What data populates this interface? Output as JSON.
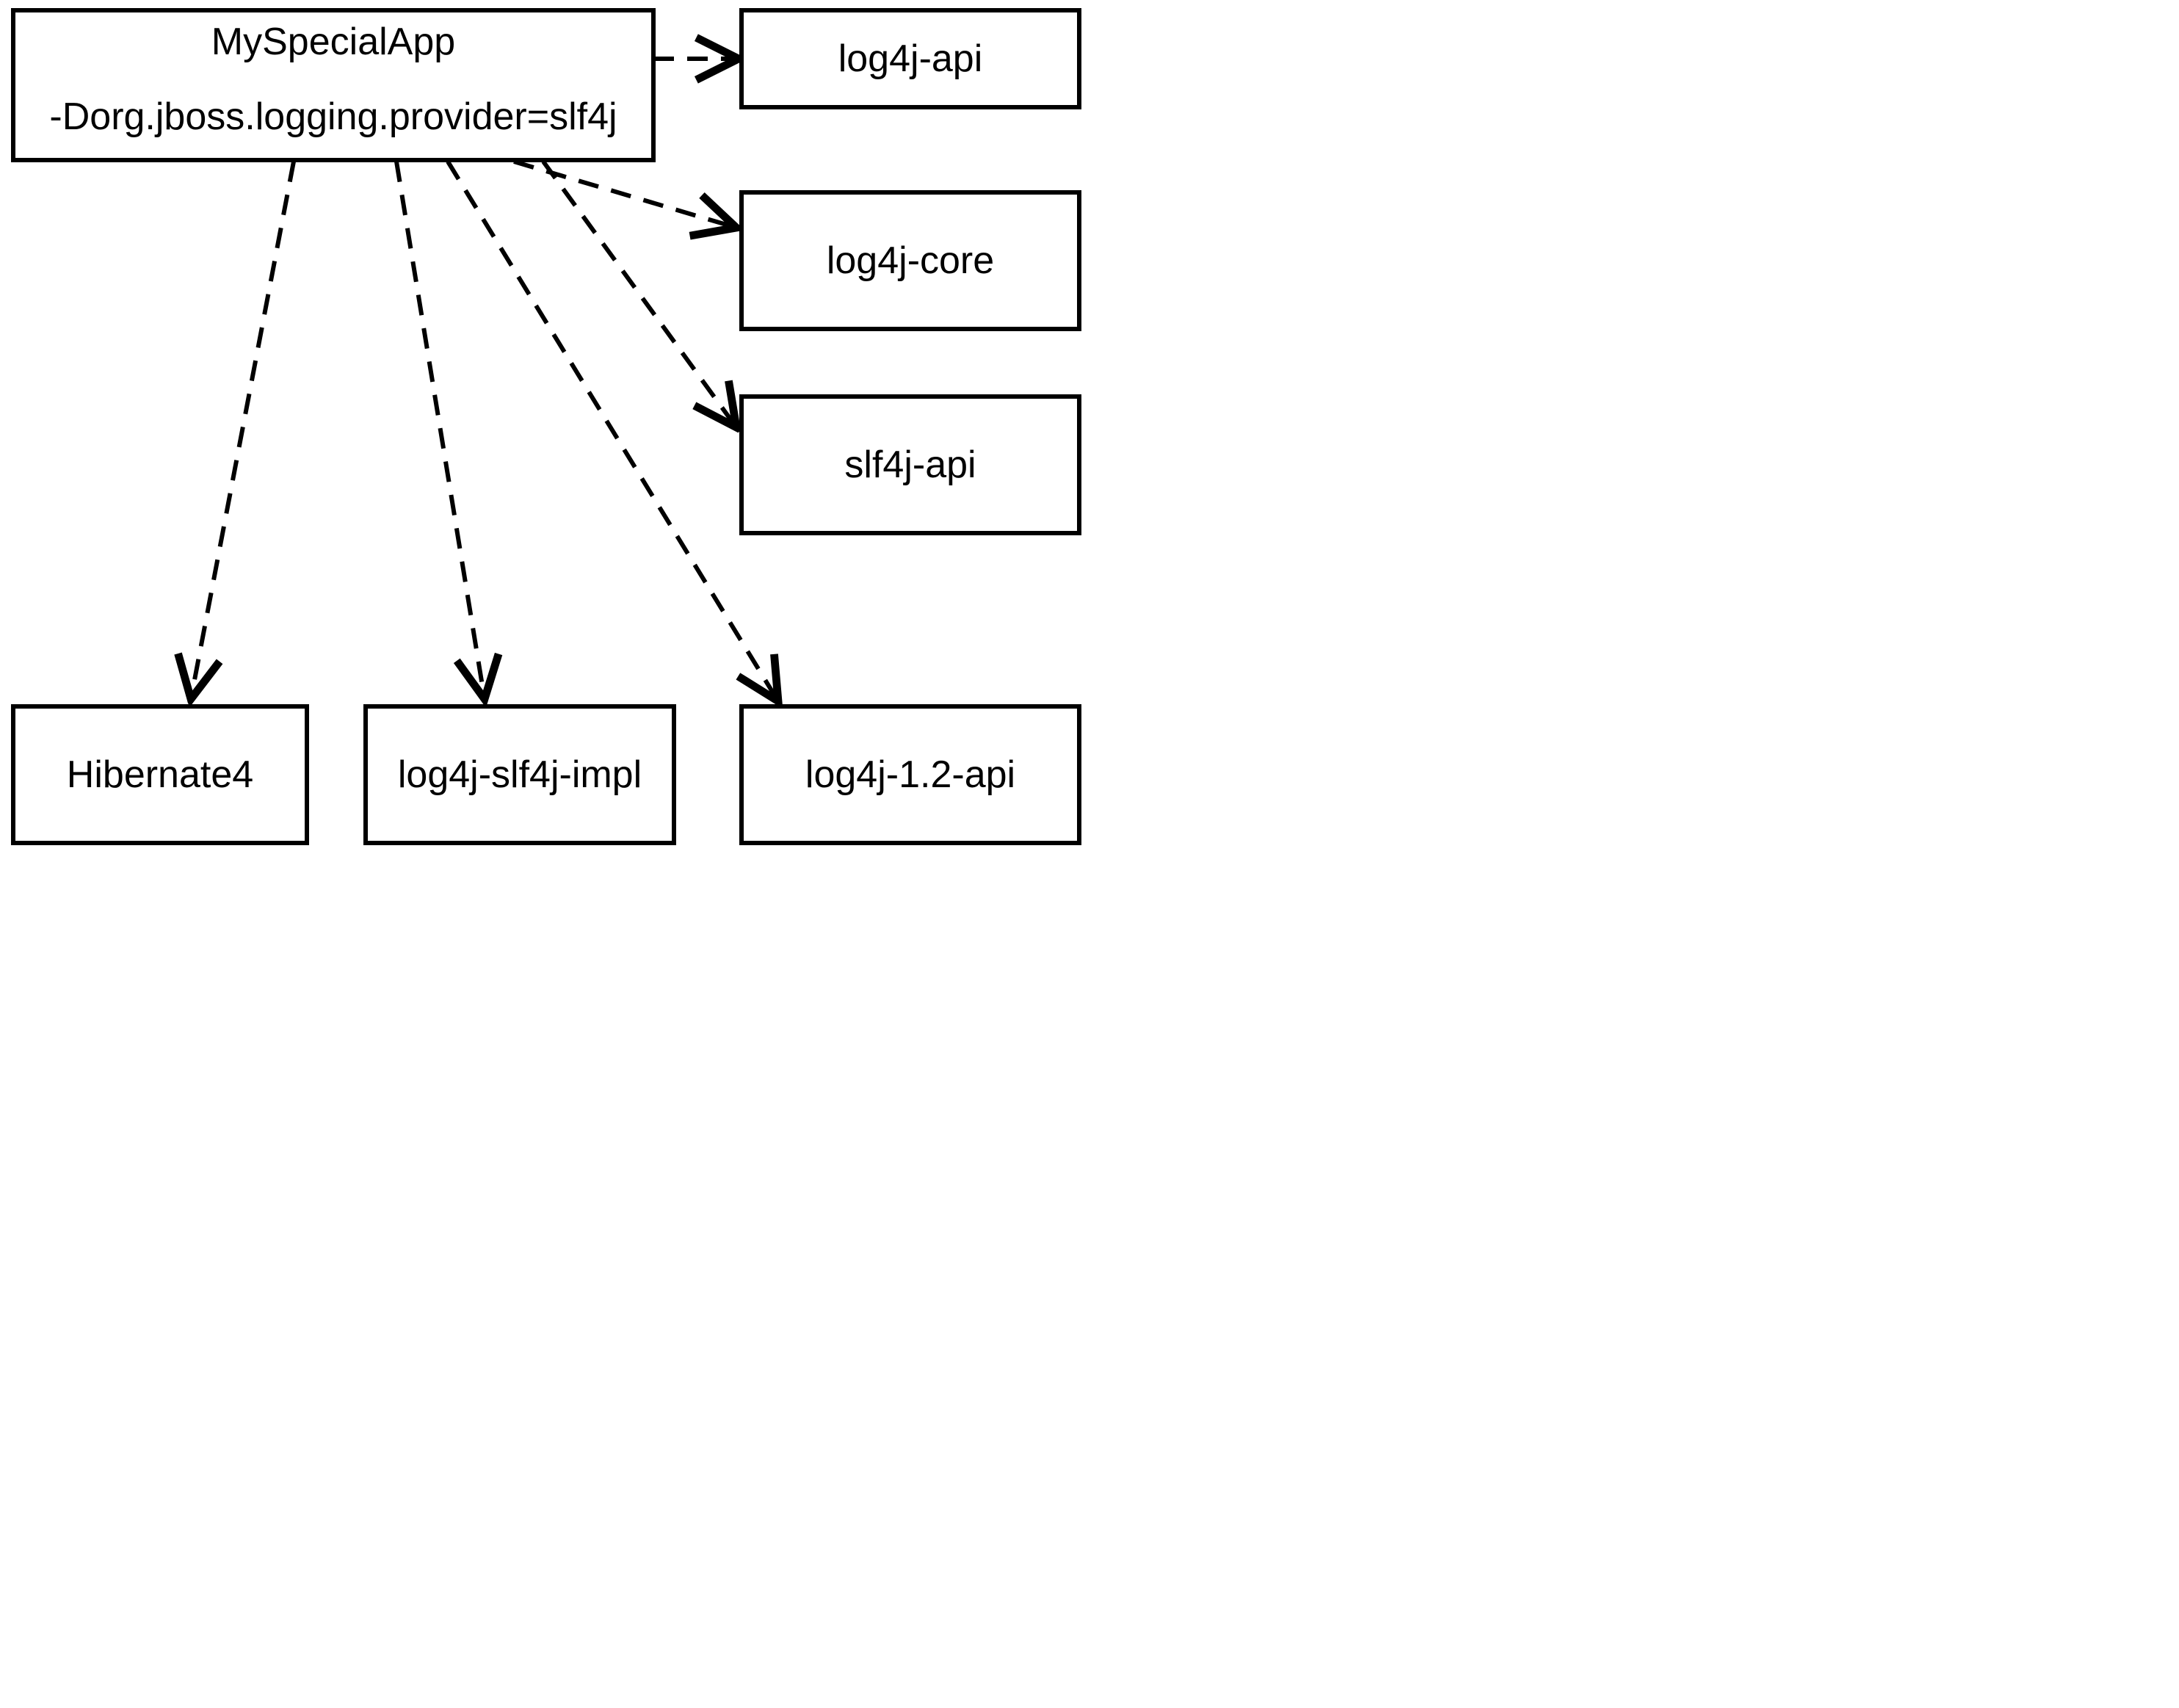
{
  "nodes": {
    "main": {
      "title": "MySpecialApp",
      "subtitle": "-Dorg.jboss.logging.provider=slf4j"
    },
    "log4jApi": {
      "label": "log4j-api"
    },
    "log4jCore": {
      "label": "log4j-core"
    },
    "slf4jApi": {
      "label": "slf4j-api"
    },
    "hibernate": {
      "label": "Hibernate4"
    },
    "slf4jImpl": {
      "label": "log4j-slf4j-impl"
    },
    "log4j12api": {
      "label": "log4j-1.2-api"
    }
  },
  "edges": [
    {
      "from": "main",
      "to": "log4jApi"
    },
    {
      "from": "main",
      "to": "log4jCore"
    },
    {
      "from": "main",
      "to": "slf4jApi"
    },
    {
      "from": "main",
      "to": "hibernate"
    },
    {
      "from": "main",
      "to": "slf4jImpl"
    },
    {
      "from": "main",
      "to": "log4j12api"
    }
  ]
}
